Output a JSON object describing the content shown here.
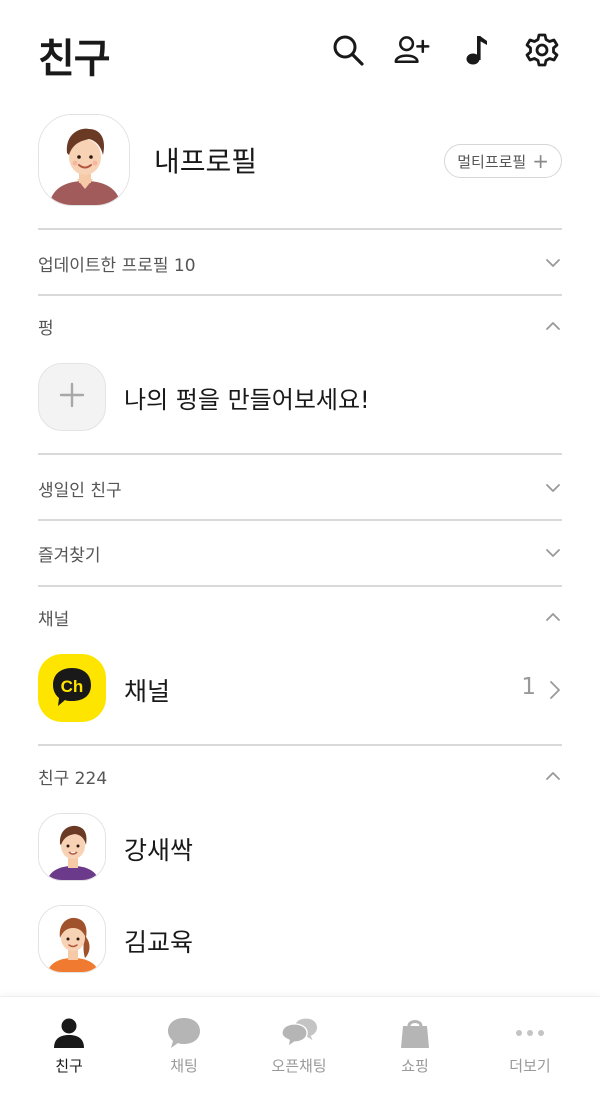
{
  "header": {
    "title": "친구",
    "icons": [
      "search-icon",
      "add-friend-icon",
      "music-icon",
      "settings-icon"
    ]
  },
  "profile": {
    "name": "내프로필",
    "multi_profile_label": "멀티프로필"
  },
  "sections": {
    "updated": {
      "label": "업데이트한 프로필 10",
      "state": "collapsed"
    },
    "pung": {
      "label": "펑",
      "state": "expanded",
      "create_text": "나의 펑을 만들어보세요!"
    },
    "birthday": {
      "label": "생일인 친구",
      "state": "collapsed"
    },
    "favorites": {
      "label": "즐겨찾기",
      "state": "collapsed"
    },
    "channel": {
      "label": "채널",
      "state": "expanded",
      "item_name": "채널",
      "item_logo": "Ch",
      "item_count": "1"
    },
    "friends": {
      "label": "친구 224",
      "state": "expanded"
    }
  },
  "friends": [
    {
      "name": "강새싹"
    },
    {
      "name": "김교육"
    }
  ],
  "tabs": [
    {
      "label": "친구",
      "icon": "person-icon",
      "active": true
    },
    {
      "label": "채팅",
      "icon": "chat-bubble-icon",
      "active": false
    },
    {
      "label": "오픈채팅",
      "icon": "open-chat-icon",
      "active": false
    },
    {
      "label": "쇼핑",
      "icon": "shopping-bag-icon",
      "active": false
    },
    {
      "label": "더보기",
      "icon": "more-icon",
      "active": false
    }
  ],
  "colors": {
    "channel_yellow": "#fee500",
    "text_primary": "#191919",
    "text_secondary": "#555555",
    "tab_inactive": "#9a9a9a"
  }
}
